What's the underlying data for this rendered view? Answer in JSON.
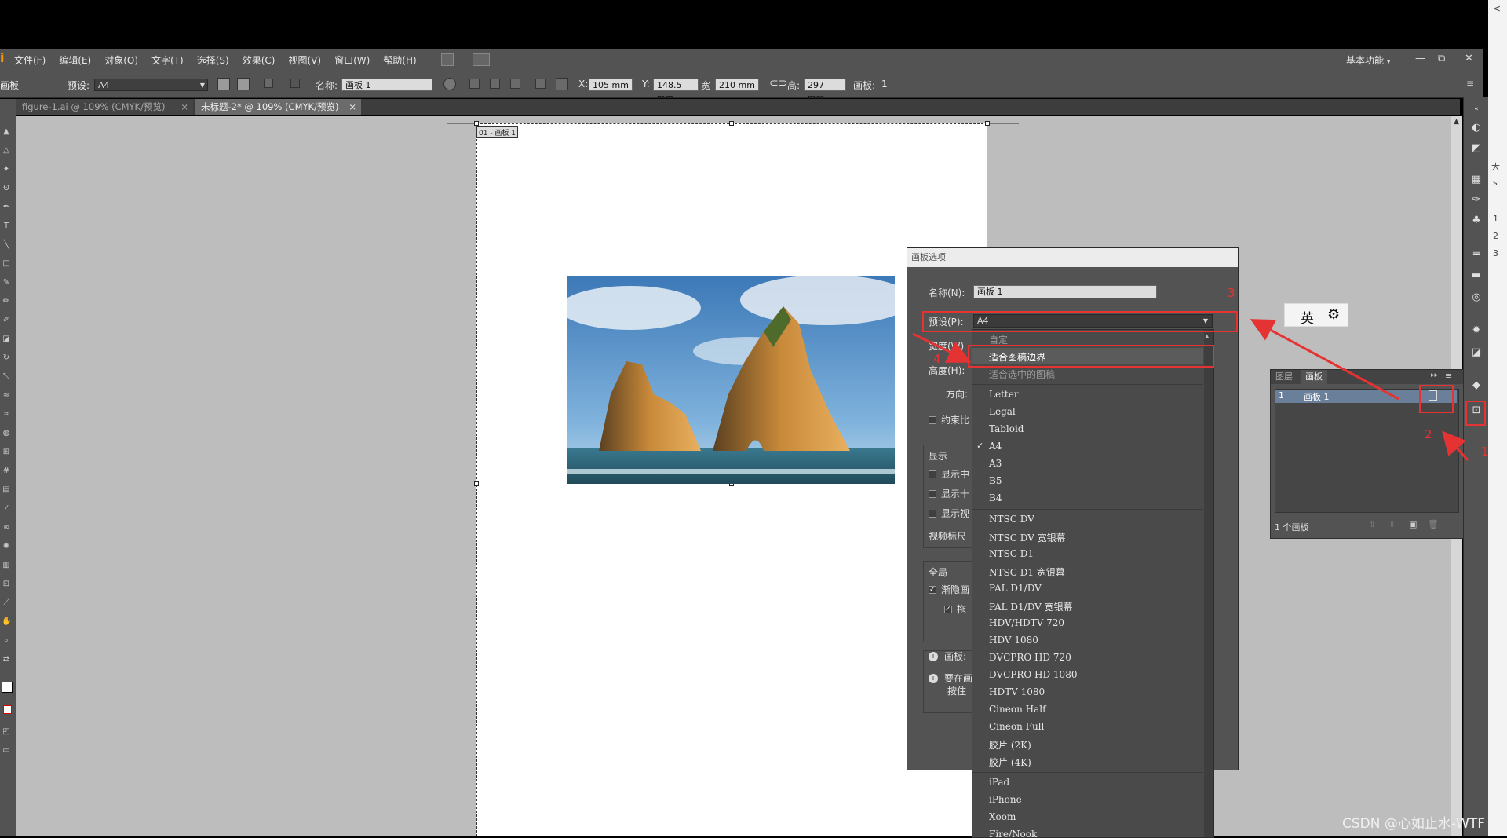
{
  "app": {
    "logo": "i"
  },
  "menu": [
    "文件(F)",
    "编辑(E)",
    "对象(O)",
    "文字(T)",
    "选择(S)",
    "效果(C)",
    "视图(V)",
    "窗口(W)",
    "帮助(H)"
  ],
  "workspace": {
    "label": "基本功能",
    "chevron": "▾"
  },
  "window_controls": {
    "minimize": "—",
    "restore": "⧉",
    "close": "✕"
  },
  "control_bar": {
    "left_label": "画板",
    "preset_label": "预设:",
    "preset_value": "A4",
    "name_label": "名称:",
    "name_value": "画板 1",
    "x_label": "X:",
    "x_value": "105 mm",
    "y_label": "Y:",
    "y_value": "148.5 mm",
    "w_label": "宽",
    "w_value": "210 mm",
    "h_label": "高:",
    "h_value": "297 mm",
    "artboards_label": "画板:",
    "artboards_value": "1"
  },
  "doc_tabs": [
    {
      "label": "figure-1.ai @ 109% (CMYK/预览)",
      "close": "×"
    },
    {
      "label": "未标题-2* @ 109% (CMYK/预览)",
      "close": "×"
    }
  ],
  "artboard_label": "01 - 画板 1",
  "dialog": {
    "title": "画板选项",
    "name_label": "名称(N):",
    "name_value": "画板 1",
    "preset_label": "预设(P):",
    "preset_value": "A4",
    "width_label": "宽度(W)",
    "height_label": "高度(H):",
    "orientation_label": "方向:",
    "constrain_label": "约束比",
    "display_header": "显示",
    "display_opts": [
      "显示中",
      "显示十",
      "显示视"
    ],
    "video_label": "视频标尺",
    "global_header": "全局",
    "global_opts": [
      "渐隐画",
      "拖"
    ],
    "info1": "画板:",
    "info2a": "要在画",
    "info2b": "按住"
  },
  "dropdown": {
    "items": [
      {
        "label": "自定",
        "disabled": true
      },
      {
        "label": "适合图稿边界",
        "highlight": true
      },
      {
        "label": "适合选中的图稿",
        "disabled": true
      },
      {
        "label": "Letter"
      },
      {
        "label": "Legal"
      },
      {
        "label": "Tabloid"
      },
      {
        "label": "A4",
        "checked": true
      },
      {
        "label": "A3"
      },
      {
        "label": "B5"
      },
      {
        "label": "B4"
      },
      {
        "label": "NTSC DV"
      },
      {
        "label": "NTSC DV 宽银幕"
      },
      {
        "label": "NTSC D1"
      },
      {
        "label": "NTSC D1 宽银幕"
      },
      {
        "label": "PAL D1/DV"
      },
      {
        "label": "PAL D1/DV 宽银幕"
      },
      {
        "label": "HDV/HDTV 720"
      },
      {
        "label": "HDV 1080"
      },
      {
        "label": "DVCPRO HD 720"
      },
      {
        "label": "DVCPRO HD 1080"
      },
      {
        "label": "HDTV 1080"
      },
      {
        "label": "Cineon Half"
      },
      {
        "label": "Cineon Full"
      },
      {
        "label": "胶片 (2K)"
      },
      {
        "label": "胶片 (4K)"
      },
      {
        "label": "iPad"
      },
      {
        "label": "iPhone"
      },
      {
        "label": "Xoom"
      },
      {
        "label": "Fire/Nook"
      }
    ]
  },
  "artboard_panel": {
    "tab_layers": "图层",
    "tab_artboards": "画板",
    "row_index": "1",
    "row_name": "画板 1",
    "footer": "1 个画板"
  },
  "annotations": {
    "n1": "1",
    "n2": "2",
    "n3": "3",
    "n4": "4"
  },
  "ime": {
    "label": "英"
  },
  "watermark": "CSDN @心如止水-WTF",
  "far_right_edge": [
    "<",
    "大",
    "s",
    "1",
    "2",
    "3"
  ]
}
